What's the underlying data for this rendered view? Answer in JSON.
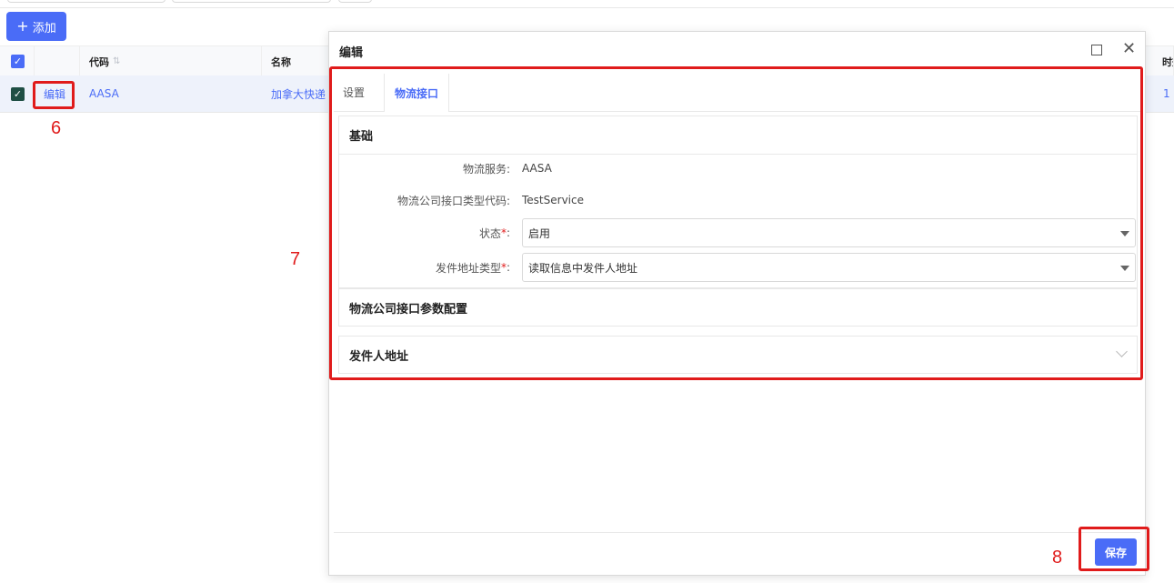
{
  "toolbar": {
    "add_label": "添加"
  },
  "table": {
    "headers": {
      "code": "代码",
      "name": "名称",
      "time": "时效"
    },
    "row": {
      "edit": "编辑",
      "code": "AASA",
      "name": "加拿大快递",
      "time": "1"
    }
  },
  "dialog": {
    "title": "编辑",
    "tabs": [
      "设置",
      "物流接口"
    ],
    "active_tab": "物流接口",
    "sections": {
      "basic": "基础",
      "params": "物流公司接口参数配置",
      "sender": "发件人地址"
    },
    "fields": {
      "service_label": "物流服务:",
      "service_value": "AASA",
      "type_code_label": "物流公司接口类型代码:",
      "type_code_value": "TestService",
      "status_label": "状态",
      "status_value": "启用",
      "addr_type_label": "发件地址类型",
      "addr_type_value": "读取信息中发件人地址",
      "required_mark": "*",
      "colon": ":"
    },
    "save_label": "保存"
  },
  "annotations": {
    "n6": "6",
    "n7": "7",
    "n8": "8"
  },
  "colors": {
    "accent": "#4a6cf7",
    "annotation": "#e01b1b"
  }
}
